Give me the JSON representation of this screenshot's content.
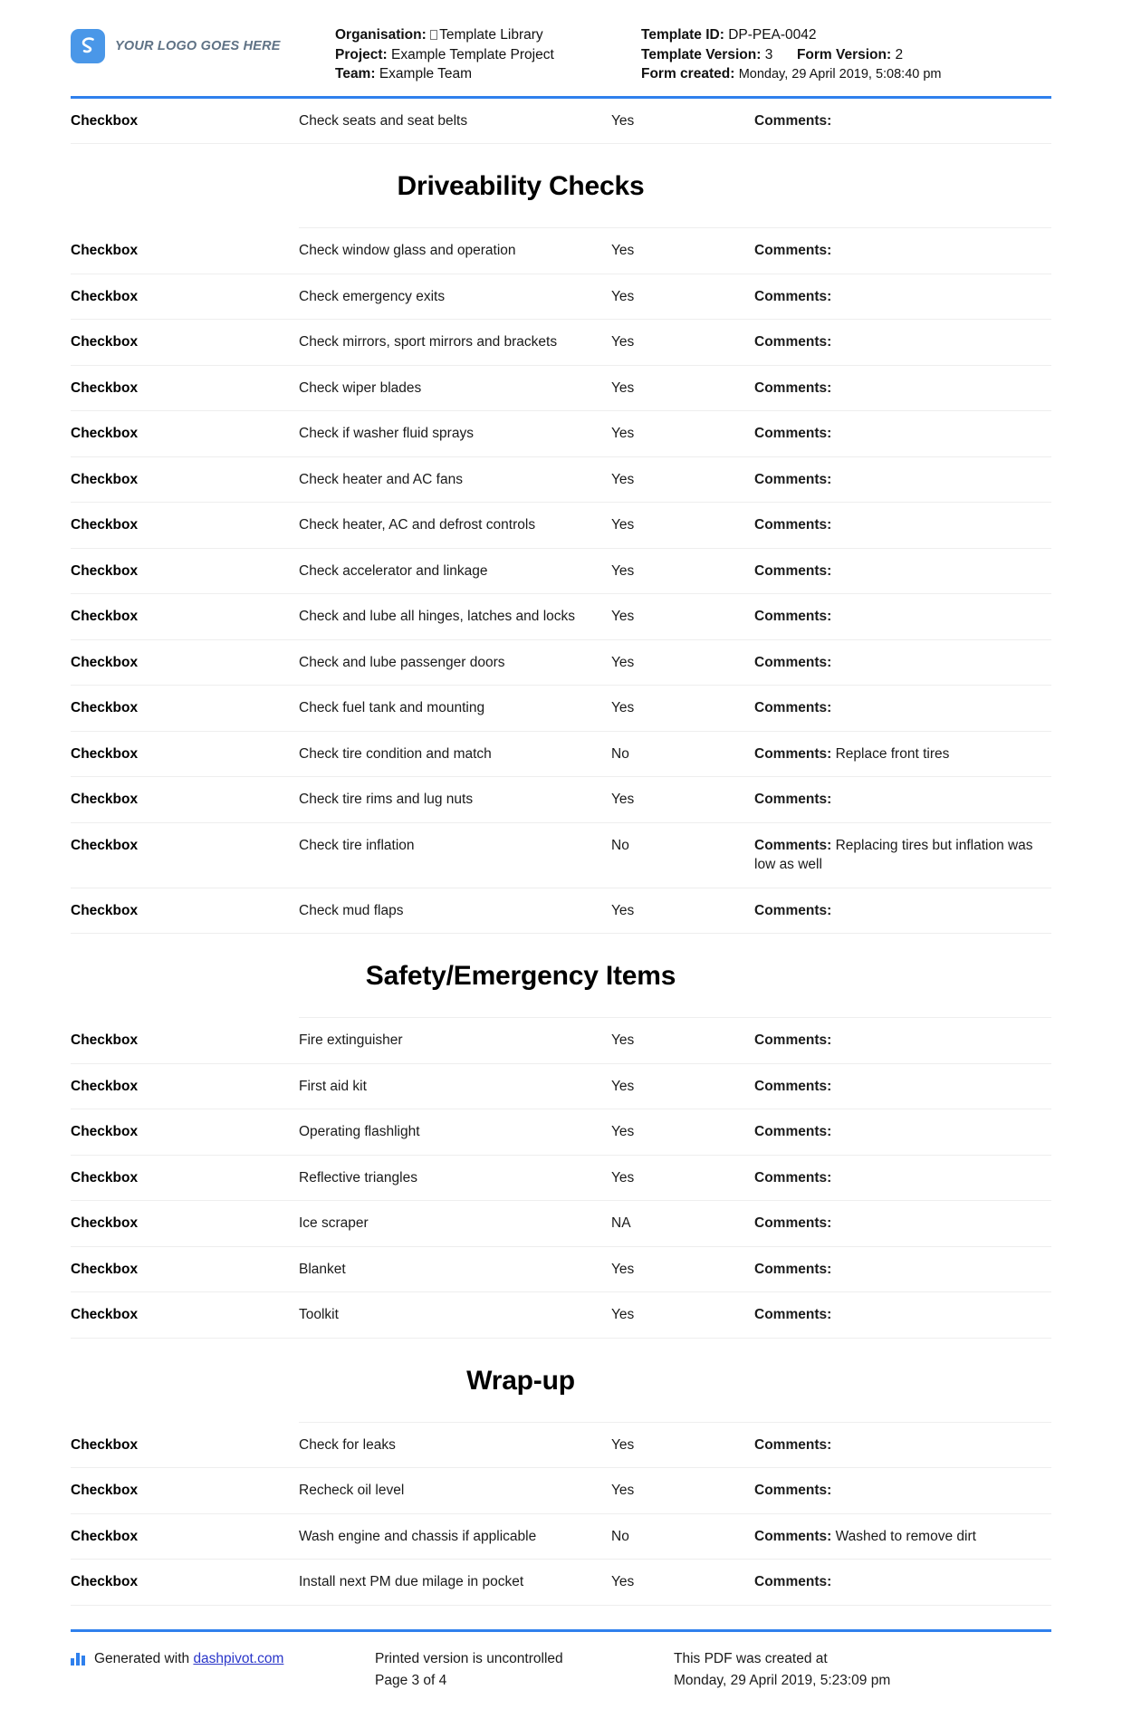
{
  "header": {
    "logo_text": "YOUR LOGO GOES HERE",
    "logo_icon": "dashpivot-logo-icon",
    "organisation_label": "Organisation:",
    "organisation_value": "Template Library",
    "project_label": "Project:",
    "project_value": "Example Template Project",
    "team_label": "Team:",
    "team_value": "Example Team",
    "template_id_label": "Template ID:",
    "template_id_value": "DP-PEA-0042",
    "template_version_label": "Template Version:",
    "template_version_value": "3",
    "form_version_label": "Form Version:",
    "form_version_value": "2",
    "form_created_label": "Form created:",
    "form_created_value": "Monday, 29 April 2019, 5:08:40 pm",
    "accent_color": "#2f80ed"
  },
  "table": {
    "field_type_label": "Checkbox",
    "comments_label": "Comments:"
  },
  "blocks": [
    {
      "type": "row",
      "label": "Checkbox",
      "description": "Check seats and seat belts",
      "answer": "Yes",
      "comments_label": "Comments:",
      "comment": ""
    },
    {
      "type": "section",
      "title": "Driveability Checks"
    },
    {
      "type": "row",
      "label": "Checkbox",
      "description": "Check window glass and operation",
      "answer": "Yes",
      "comments_label": "Comments:",
      "comment": ""
    },
    {
      "type": "row",
      "label": "Checkbox",
      "description": "Check emergency exits",
      "answer": "Yes",
      "comments_label": "Comments:",
      "comment": ""
    },
    {
      "type": "row",
      "label": "Checkbox",
      "description": "Check mirrors, sport mirrors and brackets",
      "answer": "Yes",
      "comments_label": "Comments:",
      "comment": ""
    },
    {
      "type": "row",
      "label": "Checkbox",
      "description": "Check wiper blades",
      "answer": "Yes",
      "comments_label": "Comments:",
      "comment": ""
    },
    {
      "type": "row",
      "label": "Checkbox",
      "description": "Check if washer fluid sprays",
      "answer": "Yes",
      "comments_label": "Comments:",
      "comment": ""
    },
    {
      "type": "row",
      "label": "Checkbox",
      "description": "Check heater and AC fans",
      "answer": "Yes",
      "comments_label": "Comments:",
      "comment": ""
    },
    {
      "type": "row",
      "label": "Checkbox",
      "description": "Check heater, AC and defrost controls",
      "answer": "Yes",
      "comments_label": "Comments:",
      "comment": ""
    },
    {
      "type": "row",
      "label": "Checkbox",
      "description": "Check accelerator and linkage",
      "answer": "Yes",
      "comments_label": "Comments:",
      "comment": ""
    },
    {
      "type": "row",
      "label": "Checkbox",
      "description": "Check and lube all hinges, latches and locks",
      "answer": "Yes",
      "comments_label": "Comments:",
      "comment": ""
    },
    {
      "type": "row",
      "label": "Checkbox",
      "description": "Check and lube passenger doors",
      "answer": "Yes",
      "comments_label": "Comments:",
      "comment": ""
    },
    {
      "type": "row",
      "label": "Checkbox",
      "description": "Check fuel tank and mounting",
      "answer": "Yes",
      "comments_label": "Comments:",
      "comment": ""
    },
    {
      "type": "row",
      "label": "Checkbox",
      "description": "Check tire condition and match",
      "answer": "No",
      "comments_label": "Comments:",
      "comment": "Replace front tires"
    },
    {
      "type": "row",
      "label": "Checkbox",
      "description": "Check tire rims and lug nuts",
      "answer": "Yes",
      "comments_label": "Comments:",
      "comment": ""
    },
    {
      "type": "row",
      "label": "Checkbox",
      "description": "Check tire inflation",
      "answer": "No",
      "comments_label": "Comments:",
      "comment": "Replacing tires but inflation was low as well"
    },
    {
      "type": "row",
      "label": "Checkbox",
      "description": "Check mud flaps",
      "answer": "Yes",
      "comments_label": "Comments:",
      "comment": ""
    },
    {
      "type": "section",
      "title": "Safety/Emergency Items"
    },
    {
      "type": "row",
      "label": "Checkbox",
      "description": "Fire extinguisher",
      "answer": "Yes",
      "comments_label": "Comments:",
      "comment": ""
    },
    {
      "type": "row",
      "label": "Checkbox",
      "description": "First aid kit",
      "answer": "Yes",
      "comments_label": "Comments:",
      "comment": ""
    },
    {
      "type": "row",
      "label": "Checkbox",
      "description": "Operating flashlight",
      "answer": "Yes",
      "comments_label": "Comments:",
      "comment": ""
    },
    {
      "type": "row",
      "label": "Checkbox",
      "description": "Reflective triangles",
      "answer": "Yes",
      "comments_label": "Comments:",
      "comment": ""
    },
    {
      "type": "row",
      "label": "Checkbox",
      "description": "Ice scraper",
      "answer": "NA",
      "comments_label": "Comments:",
      "comment": ""
    },
    {
      "type": "row",
      "label": "Checkbox",
      "description": "Blanket",
      "answer": "Yes",
      "comments_label": "Comments:",
      "comment": ""
    },
    {
      "type": "row",
      "label": "Checkbox",
      "description": "Toolkit",
      "answer": "Yes",
      "comments_label": "Comments:",
      "comment": ""
    },
    {
      "type": "section",
      "title": "Wrap-up"
    },
    {
      "type": "row",
      "label": "Checkbox",
      "description": "Check for leaks",
      "answer": "Yes",
      "comments_label": "Comments:",
      "comment": ""
    },
    {
      "type": "row",
      "label": "Checkbox",
      "description": "Recheck oil level",
      "answer": "Yes",
      "comments_label": "Comments:",
      "comment": ""
    },
    {
      "type": "row",
      "label": "Checkbox",
      "description": "Wash engine and chassis if applicable",
      "answer": "No",
      "comments_label": "Comments:",
      "comment": "Washed to remove dirt"
    },
    {
      "type": "row",
      "label": "Checkbox",
      "description": "Install next PM due milage in pocket",
      "answer": "Yes",
      "comments_label": "Comments:",
      "comment": ""
    }
  ],
  "footer": {
    "generated_prefix": "Generated with",
    "generated_link": "dashpivot.com",
    "generated_icon": "bar-chart-icon",
    "printed_notice": "Printed version is uncontrolled",
    "page_number": "Page 3 of 4",
    "created_notice": "This PDF was created at",
    "created_timestamp": "Monday, 29 April 2019, 5:23:09 pm"
  }
}
